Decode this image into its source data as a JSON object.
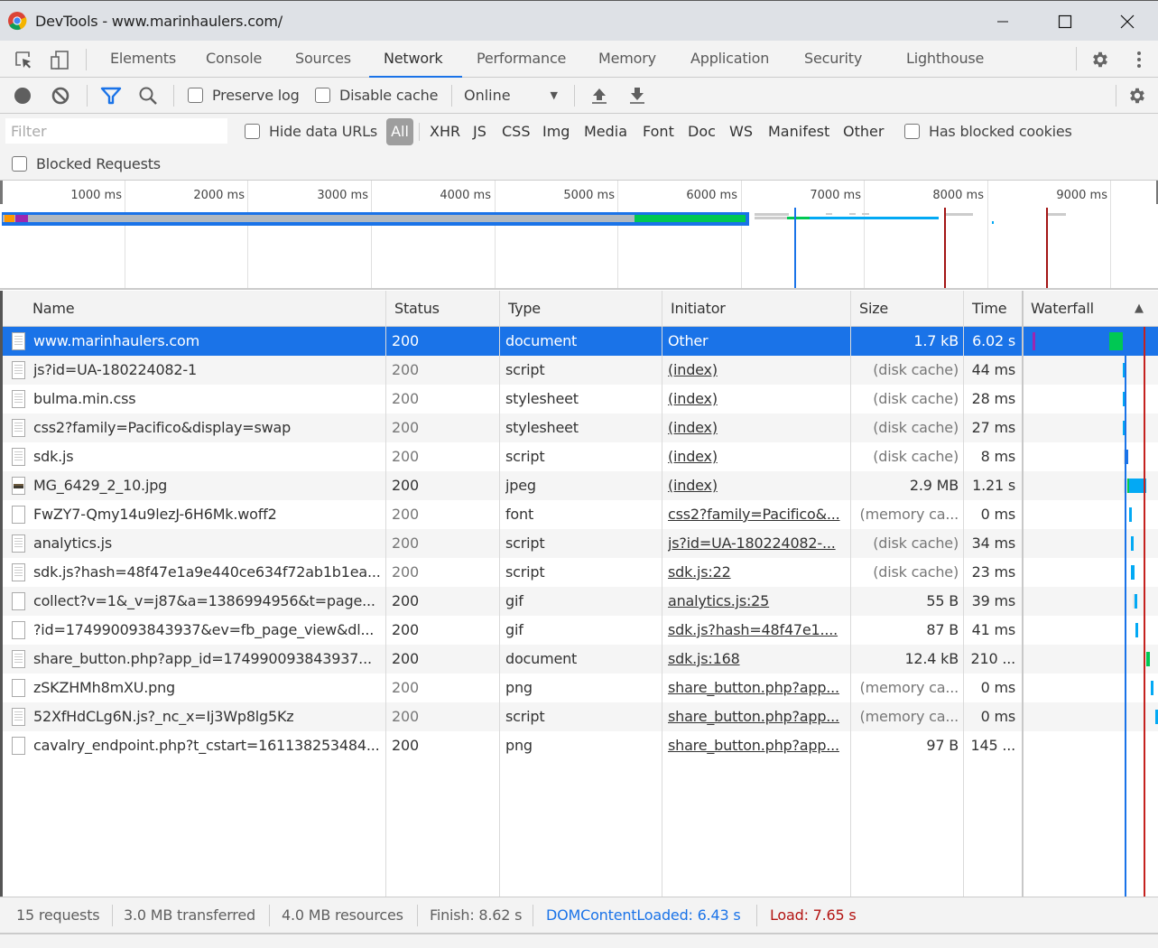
{
  "window": {
    "title": "DevTools - www.marinhaulers.com/"
  },
  "tabs": [
    {
      "label": "Elements"
    },
    {
      "label": "Console"
    },
    {
      "label": "Sources"
    },
    {
      "label": "Network",
      "active": true
    },
    {
      "label": "Performance"
    },
    {
      "label": "Memory"
    },
    {
      "label": "Application"
    },
    {
      "label": "Security"
    },
    {
      "label": "Lighthouse"
    }
  ],
  "toolbar": {
    "preserve_log": "Preserve log",
    "disable_cache": "Disable cache",
    "throttling": "Online"
  },
  "filterbar": {
    "filter_placeholder": "Filter",
    "hide_data_urls": "Hide data URLs",
    "types": [
      "All",
      "XHR",
      "JS",
      "CSS",
      "Img",
      "Media",
      "Font",
      "Doc",
      "WS",
      "Manifest",
      "Other"
    ],
    "active_type": "All",
    "has_blocked_cookies": "Has blocked cookies",
    "blocked_requests": "Blocked Requests"
  },
  "overview": {
    "ticks": [
      "1000 ms",
      "2000 ms",
      "3000 ms",
      "4000 ms",
      "5000 ms",
      "6000 ms",
      "7000 ms",
      "8000 ms",
      "9000 ms"
    ]
  },
  "columns": {
    "name": "Name",
    "status": "Status",
    "type": "Type",
    "initiator": "Initiator",
    "size": "Size",
    "time": "Time",
    "waterfall": "Waterfall"
  },
  "requests": [
    {
      "name": "www.marinhaulers.com",
      "status": "200",
      "type": "document",
      "initiator": "Other",
      "size": "1.7 kB",
      "time": "6.02 s",
      "icon": "doc",
      "selected": true,
      "dim": false
    },
    {
      "name": "js?id=UA-180224082-1",
      "status": "200",
      "type": "script",
      "initiator": "(index)",
      "size": "(disk cache)",
      "time": "44 ms",
      "icon": "doc",
      "dim": true
    },
    {
      "name": "bulma.min.css",
      "status": "200",
      "type": "stylesheet",
      "initiator": "(index)",
      "size": "(disk cache)",
      "time": "28 ms",
      "icon": "doc",
      "dim": true
    },
    {
      "name": "css2?family=Pacifico&display=swap",
      "status": "200",
      "type": "stylesheet",
      "initiator": "(index)",
      "size": "(disk cache)",
      "time": "27 ms",
      "icon": "doc",
      "dim": true
    },
    {
      "name": "sdk.js",
      "status": "200",
      "type": "script",
      "initiator": "(index)",
      "size": "(disk cache)",
      "time": "8 ms",
      "icon": "doc",
      "dim": true
    },
    {
      "name": "MG_6429_2_10.jpg",
      "status": "200",
      "type": "jpeg",
      "initiator": "(index)",
      "size": "2.9 MB",
      "time": "1.21 s",
      "icon": "img",
      "dim": false
    },
    {
      "name": "FwZY7-Qmy14u9lezJ-6H6Mk.woff2",
      "status": "200",
      "type": "font",
      "initiator": "css2?family=Pacifico&...",
      "size": "(memory ca...",
      "time": "0 ms",
      "icon": "blank",
      "dim": true
    },
    {
      "name": "analytics.js",
      "status": "200",
      "type": "script",
      "initiator": "js?id=UA-180224082-...",
      "size": "(disk cache)",
      "time": "34 ms",
      "icon": "doc",
      "dim": true
    },
    {
      "name": "sdk.js?hash=48f47e1a9e440ce634f72ab1b1ea...",
      "status": "200",
      "type": "script",
      "initiator": "sdk.js:22",
      "size": "(disk cache)",
      "time": "23 ms",
      "icon": "doc",
      "dim": true
    },
    {
      "name": "collect?v=1&_v=j87&a=1386994956&t=page...",
      "status": "200",
      "type": "gif",
      "initiator": "analytics.js:25",
      "size": "55 B",
      "time": "39 ms",
      "icon": "blank",
      "dim": false
    },
    {
      "name": "?id=174990093843937&ev=fb_page_view&dl...",
      "status": "200",
      "type": "gif",
      "initiator": "sdk.js?hash=48f47e1....",
      "size": "87 B",
      "time": "41 ms",
      "icon": "blank",
      "dim": false
    },
    {
      "name": "share_button.php?app_id=174990093843937...",
      "status": "200",
      "type": "document",
      "initiator": "sdk.js:168",
      "size": "12.4 kB",
      "time": "210 ...",
      "icon": "doc",
      "dim": false
    },
    {
      "name": "zSKZHMh8mXU.png",
      "status": "200",
      "type": "png",
      "initiator": "share_button.php?app...",
      "size": "(memory ca...",
      "time": "0 ms",
      "icon": "blank",
      "dim": true
    },
    {
      "name": "52XfHdCLg6N.js?_nc_x=Ij3Wp8lg5Kz",
      "status": "200",
      "type": "script",
      "initiator": "share_button.php?app...",
      "size": "(memory ca...",
      "time": "0 ms",
      "icon": "doc",
      "dim": true
    },
    {
      "name": "cavalry_endpoint.php?t_cstart=161138253484...",
      "status": "200",
      "type": "png",
      "initiator": "share_button.php?app...",
      "size": "97 B",
      "time": "145 ...",
      "icon": "blank",
      "dim": false
    }
  ],
  "summary": {
    "requests": "15 requests",
    "transferred": "3.0 MB transferred",
    "resources": "4.0 MB resources",
    "finish": "Finish: 8.62 s",
    "dom_content_loaded": "DOMContentLoaded: 6.43 s",
    "load": "Load: 7.65 s"
  },
  "colors": {
    "accent": "#1a73e8",
    "dcl": "#1a73e8",
    "load": "#c5221f",
    "waiting": "#00c853",
    "download": "#03a9f4"
  }
}
